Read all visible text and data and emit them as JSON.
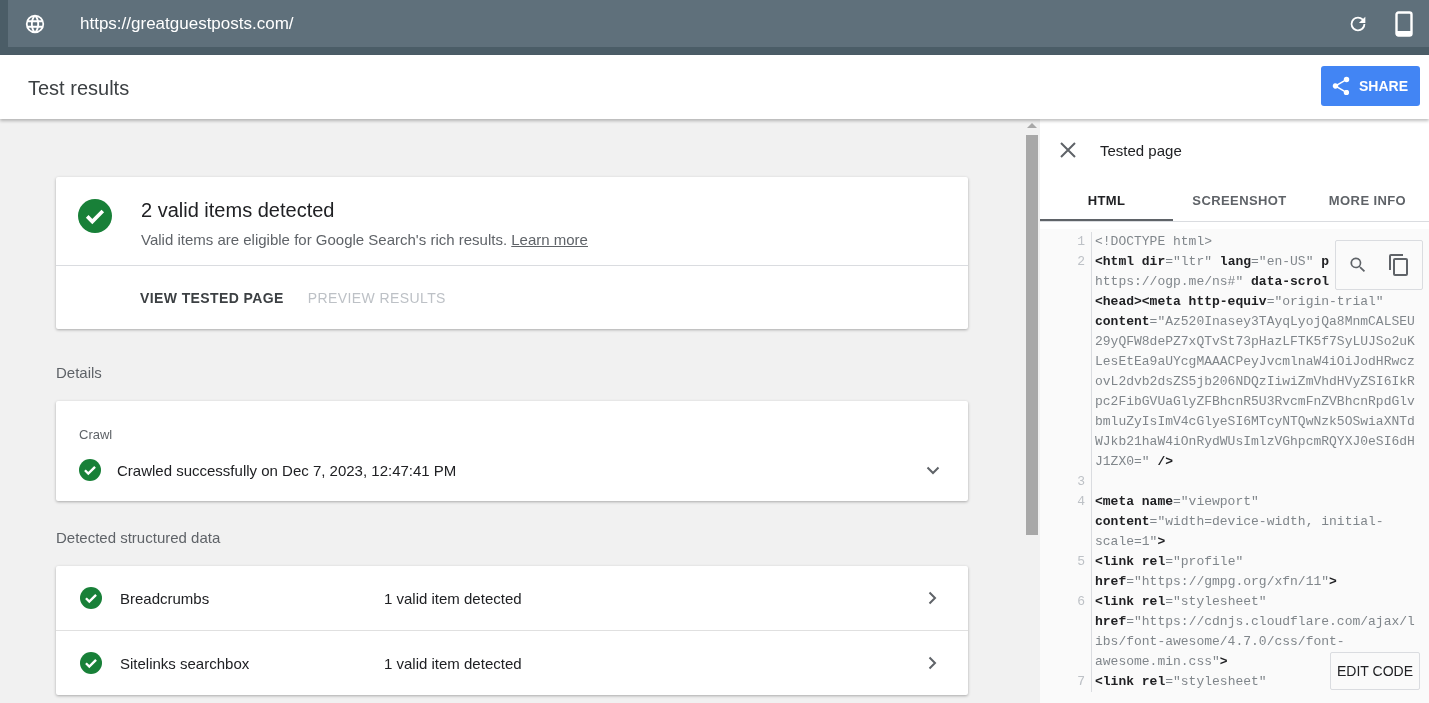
{
  "address_bar": {
    "url": "https://greatguestposts.com/"
  },
  "header": {
    "title": "Test results",
    "share_button": "SHARE"
  },
  "summary": {
    "valid": true,
    "title": "2 valid items detected",
    "description": "Valid items are eligible for Google Search's rich results.",
    "link": "Learn more",
    "actions": [
      {
        "label": "VIEW TESTED PAGE",
        "disabled": false
      },
      {
        "label": "PREVIEW RESULTS",
        "disabled": true
      }
    ]
  },
  "details": {
    "heading": "Details",
    "crawl": {
      "label": "Crawl",
      "valid": true,
      "text": "Crawled successfully on Dec 7, 2023, 12:47:41 PM",
      "expanded": false
    }
  },
  "structured_data": {
    "heading": "Detected structured data",
    "items": [
      {
        "name": "Breadcrumbs",
        "valid": true,
        "result": "1 valid item detected"
      },
      {
        "name": "Sitelinks searchbox",
        "valid": true,
        "result": "1 valid item detected"
      }
    ]
  },
  "tested_page": {
    "title": "Tested page",
    "tabs": [
      {
        "label": "HTML",
        "selected": true
      },
      {
        "label": "SCREENSHOT",
        "selected": false
      },
      {
        "label": "MORE INFO",
        "selected": false
      }
    ],
    "code": [
      {
        "number": "1",
        "rows": [
          [
            {
              "kind": "comment",
              "text": "<!DOCTYPE html>"
            }
          ]
        ]
      },
      {
        "number": "2",
        "rows": [
          [
            {
              "kind": "markup",
              "text": "<html dir"
            },
            {
              "kind": "value",
              "text": "=\"ltr\" "
            },
            {
              "kind": "markup",
              "text": "lang"
            },
            {
              "kind": "value",
              "text": "=\"en-US\" "
            },
            {
              "kind": "markup",
              "text": "p"
            }
          ],
          [
            {
              "kind": "value",
              "text": "https://ogp.me/ns#\" "
            },
            {
              "kind": "markup",
              "text": "data-scrol"
            }
          ],
          [
            {
              "kind": "markup",
              "text": "<head><meta http-equiv"
            },
            {
              "kind": "value",
              "text": "=\"origin-trial\""
            }
          ],
          [
            {
              "kind": "markup",
              "text": "content"
            },
            {
              "kind": "value",
              "text": "=\"Az520Inasey3TAyqLyojQa8MnmCALSEU"
            }
          ],
          [
            {
              "kind": "value",
              "text": "29yQFW8dePZ7xQTvSt73pHazLFTK5f7SyLUJSo2uK"
            }
          ],
          [
            {
              "kind": "value",
              "text": "LesEtEa9aUYcgMAAACPeyJvcmlnaW4iOiJodHRwcz"
            }
          ],
          [
            {
              "kind": "value",
              "text": "ovL2dvb2dsZS5jb206NDQzIiwiZmVhdHVyZSI6IkR"
            }
          ],
          [
            {
              "kind": "value",
              "text": "pc2FibGVUaGlyZFBhcnR5U3RvcmFnZVBhcnRpdGlv"
            }
          ],
          [
            {
              "kind": "value",
              "text": "bmluZyIsImV4cGlyeSI6MTcyNTQwNzk5OSwiaXNTd"
            }
          ],
          [
            {
              "kind": "value",
              "text": "WJkb21haW4iOnRydWUsImlzVGhpcmRQYXJ0eSI6dH"
            }
          ],
          [
            {
              "kind": "value",
              "text": "J1ZX0=\" "
            },
            {
              "kind": "markup",
              "text": "/>"
            }
          ]
        ]
      },
      {
        "number": "3"
      },
      {
        "number": "4",
        "rows": [
          [
            {
              "kind": "markup",
              "text": "<meta name"
            },
            {
              "kind": "value",
              "text": "=\"viewport\""
            }
          ],
          [
            {
              "kind": "markup",
              "text": "content"
            },
            {
              "kind": "value",
              "text": "=\"width=device-width, initial-"
            }
          ],
          [
            {
              "kind": "value",
              "text": "scale=1\""
            },
            {
              "kind": "markup",
              "text": ">"
            }
          ]
        ]
      },
      {
        "number": "5",
        "rows": [
          [
            {
              "kind": "markup",
              "text": "<link rel"
            },
            {
              "kind": "value",
              "text": "=\"profile\""
            }
          ],
          [
            {
              "kind": "markup",
              "text": "href"
            },
            {
              "kind": "value",
              "text": "=\"https://gmpg.org/xfn/11\""
            },
            {
              "kind": "markup",
              "text": ">"
            }
          ]
        ]
      },
      {
        "number": "6",
        "rows": [
          [
            {
              "kind": "markup",
              "text": "<link rel"
            },
            {
              "kind": "value",
              "text": "=\"stylesheet\""
            }
          ],
          [
            {
              "kind": "markup",
              "text": "href"
            },
            {
              "kind": "value",
              "text": "=\"https://cdnjs.cloudflare.com/ajax/l"
            }
          ],
          [
            {
              "kind": "value",
              "text": "ibs/font-awesome/4.7.0/css/font-"
            }
          ],
          [
            {
              "kind": "value",
              "text": "awesome.min.css\""
            },
            {
              "kind": "markup",
              "text": ">"
            }
          ]
        ]
      },
      {
        "number": "7",
        "rows": [
          [
            {
              "kind": "markup",
              "text": "<link rel"
            },
            {
              "kind": "value",
              "text": "=\"stylesheet\""
            }
          ]
        ]
      }
    ],
    "edit_button": "EDIT CODE"
  }
}
